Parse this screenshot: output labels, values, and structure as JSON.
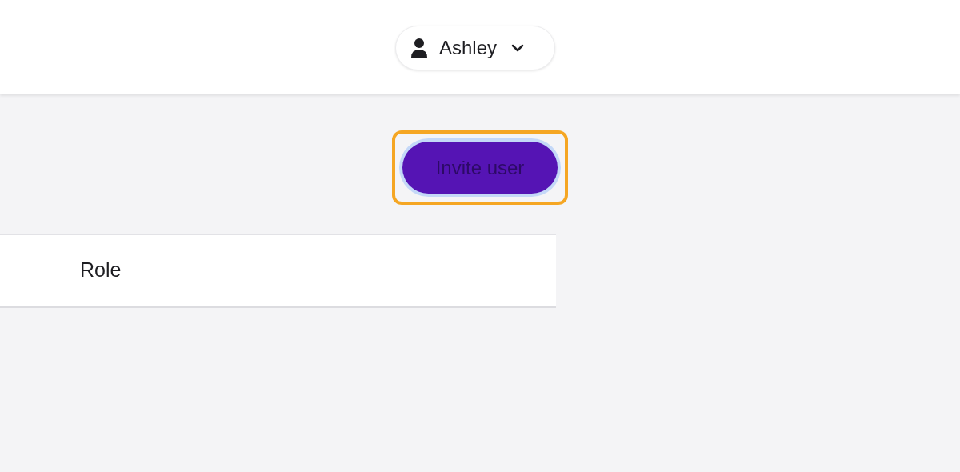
{
  "header": {
    "user_menu": {
      "label": "Ashley"
    }
  },
  "invite_button": {
    "label": "Invite user",
    "highlighted": true
  },
  "table": {
    "columns": [
      {
        "label": "Role"
      }
    ]
  }
}
